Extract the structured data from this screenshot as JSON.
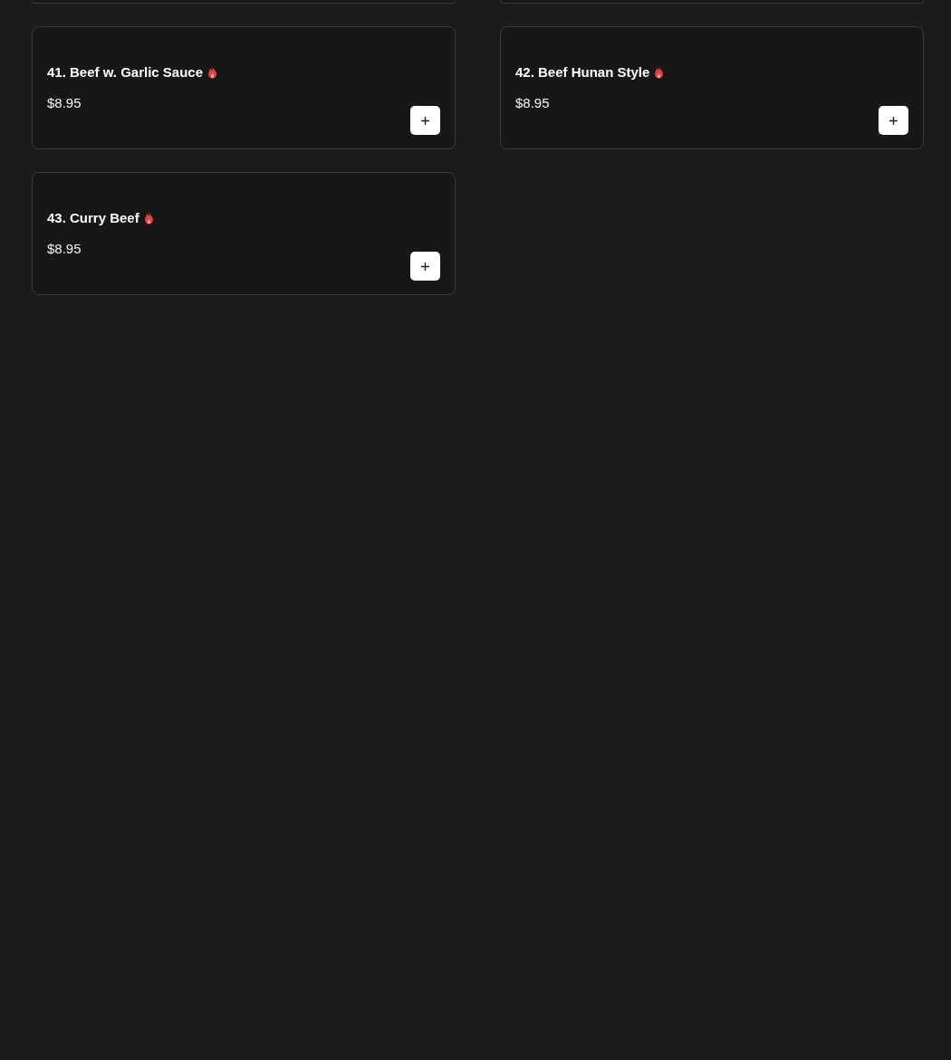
{
  "items": [
    {
      "name": "41. Beef w. Garlic Sauce",
      "spicy": true,
      "price": "$8.95"
    },
    {
      "name": "42. Beef Hunan Style",
      "spicy": true,
      "price": "$8.95"
    },
    {
      "name": "43. Curry Beef",
      "spicy": true,
      "price": "$8.95"
    }
  ]
}
